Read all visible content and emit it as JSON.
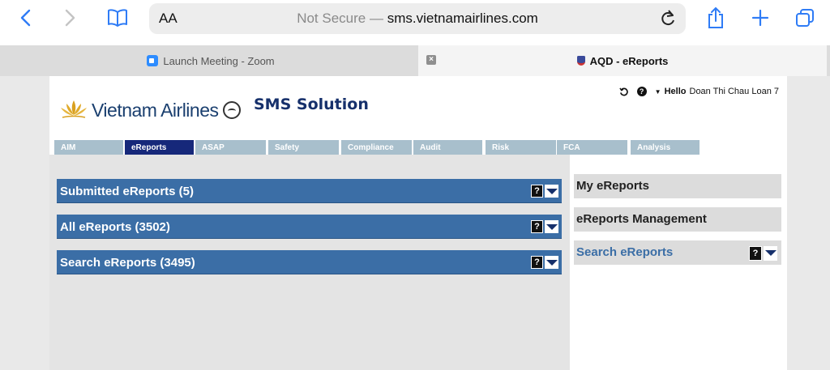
{
  "browser": {
    "address": {
      "text_size_label": "AA",
      "security": "Not Secure",
      "separator": "—",
      "domain": "sms.vietnamairlines.com"
    },
    "tabs": [
      {
        "title": "Launch Meeting - Zoom",
        "icon": "zoom-icon"
      },
      {
        "title": "AQD - eReports",
        "icon": "shield-icon"
      }
    ]
  },
  "app": {
    "brand": "Vietnam Airlines",
    "product": "SMS Solution",
    "user": {
      "greeting": "Hello",
      "name": "Doan Thi Chau Loan 7"
    },
    "nav": [
      "AIM",
      "eReports",
      "ASAP",
      "Safety",
      "Compliance",
      "Audit",
      "Risk",
      "FCA",
      "Analysis"
    ],
    "active_nav": "eReports",
    "panels": [
      {
        "title": "Submitted eReports (5)"
      },
      {
        "title": "All eReports (3502)"
      },
      {
        "title": "Search eReports (3495)"
      }
    ],
    "sidebar": [
      {
        "label": "My eReports"
      },
      {
        "label": "eReports Management"
      },
      {
        "label": "Search eReports"
      }
    ],
    "help_symbol": "?"
  },
  "colors": {
    "accent": "#2f7cf6",
    "panel_blue": "#3b6ea6",
    "nav_active": "#16287a",
    "nav_inactive": "#a8bfcc"
  }
}
